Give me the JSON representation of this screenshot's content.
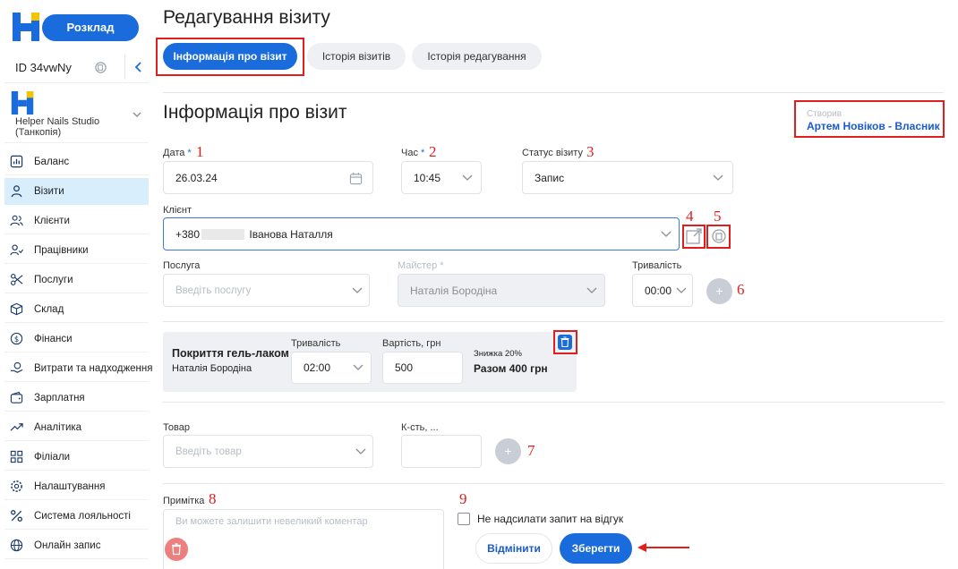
{
  "sidebar": {
    "schedule_button": "Розклад",
    "id_text": "ID 34vwNy",
    "studio_name": "Helper Nails Studio (Танкопія)",
    "items": [
      {
        "label": "Баланс",
        "icon": "chart-bar-icon"
      },
      {
        "label": "Візити",
        "icon": "user-icon"
      },
      {
        "label": "Клієнти",
        "icon": "users-icon"
      },
      {
        "label": "Працівники",
        "icon": "staff-icon"
      },
      {
        "label": "Послуги",
        "icon": "scissors-icon"
      },
      {
        "label": "Склад",
        "icon": "box-icon"
      },
      {
        "label": "Фінанси",
        "icon": "dollar-icon"
      },
      {
        "label": "Витрати та надходження",
        "icon": "money-hand-icon"
      },
      {
        "label": "Зарплатня",
        "icon": "wallet-icon"
      },
      {
        "label": "Аналітика",
        "icon": "trend-icon"
      },
      {
        "label": "Філіали",
        "icon": "grid-icon"
      },
      {
        "label": "Налаштування",
        "icon": "gear-icon"
      },
      {
        "label": "Система лояльності",
        "icon": "percent-icon"
      },
      {
        "label": "Онлайн запис",
        "icon": "globe-icon"
      }
    ]
  },
  "header": {
    "title": "Редагування візиту",
    "tabs": [
      "Інформація про візит",
      "Історія візитів",
      "Історія редагування"
    ]
  },
  "section": {
    "title": "Інформація про візит",
    "created_label": "Створив",
    "created_by": "Артем Новіков - Власник"
  },
  "form": {
    "date": {
      "label": "Дата",
      "required": "*",
      "value": "26.03.24"
    },
    "time": {
      "label": "Час",
      "required": "*",
      "value": "10:45"
    },
    "status": {
      "label": "Статус візиту",
      "value": "Запис"
    },
    "client": {
      "label": "Клієнт",
      "phone_prefix": "+380",
      "name": "Іванова Наталля"
    },
    "service": {
      "label": "Послуга",
      "placeholder": "Введіть послугу"
    },
    "master": {
      "label": "Майстер *",
      "value": "Наталія Бородіна"
    },
    "duration": {
      "label": "Тривалість",
      "value": "00:00"
    },
    "product": {
      "label": "Товар",
      "placeholder": "Введіть товар"
    },
    "qty": {
      "label": "К-сть, ..."
    },
    "note": {
      "label": "Примітка",
      "placeholder": "Ви можете залишити невеликий коментар"
    },
    "no_review": "Не надсилати запит на відгук"
  },
  "service_card": {
    "name": "Покриття гель-лаком",
    "master": "Наталія Бородіна",
    "duration_label": "Тривалість",
    "duration": "02:00",
    "cost_label": "Вартість, грн",
    "cost": "500",
    "discount": "Знижка 20%",
    "total": "Разом 400 грн"
  },
  "buttons": {
    "cancel": "Відмінити",
    "save": "Зберегти",
    "plus": "+"
  },
  "annotations": [
    "1",
    "2",
    "3",
    "4",
    "5",
    "6",
    "7",
    "8",
    "9"
  ],
  "colors": {
    "accent": "#1a6bdc",
    "annotation": "#e01e1e",
    "danger": "#ee7f7f"
  }
}
